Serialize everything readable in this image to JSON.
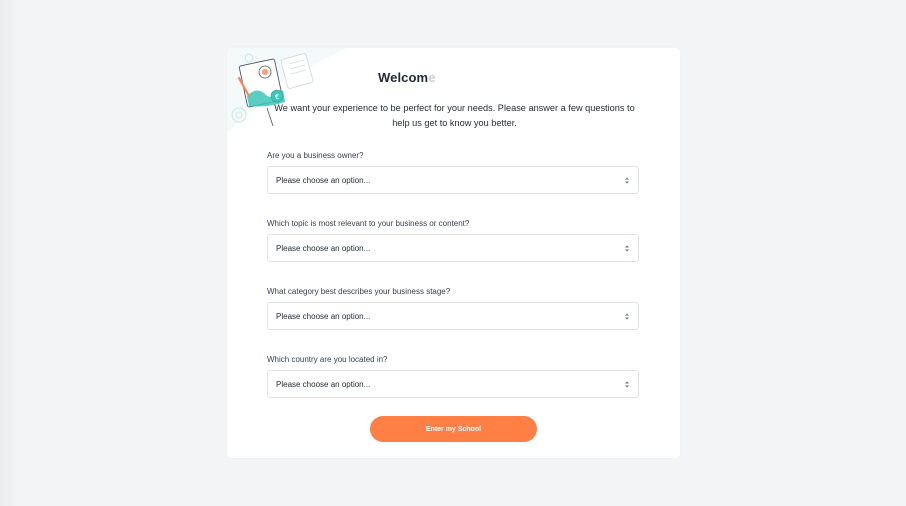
{
  "header": {
    "welcome_visible": "Welcom",
    "welcome_faded": "e",
    "subtitle": "We want your experience to be perfect for your needs. Please answer a few questions to help us get to know you better."
  },
  "questions": [
    {
      "label": "Are you a business owner?",
      "selected": "Please choose an option..."
    },
    {
      "label": "Which topic is most relevant to your business or content?",
      "selected": "Please choose an option..."
    },
    {
      "label": "What category best describes your business stage?",
      "selected": "Please choose an option..."
    },
    {
      "label": "Which country are you located in?",
      "selected": "Please choose an option..."
    }
  ],
  "submit": {
    "label": "Enter my School"
  },
  "icons": {
    "select_caret": "updown-caret-icon",
    "illustration": "onboarding-illustration"
  },
  "colors": {
    "accent": "#ff7f45",
    "background": "#f3f4f6",
    "card": "#ffffff",
    "text": "#1f2937",
    "border": "#dfe2e7",
    "illustration_teal": "#3ec6b8"
  }
}
